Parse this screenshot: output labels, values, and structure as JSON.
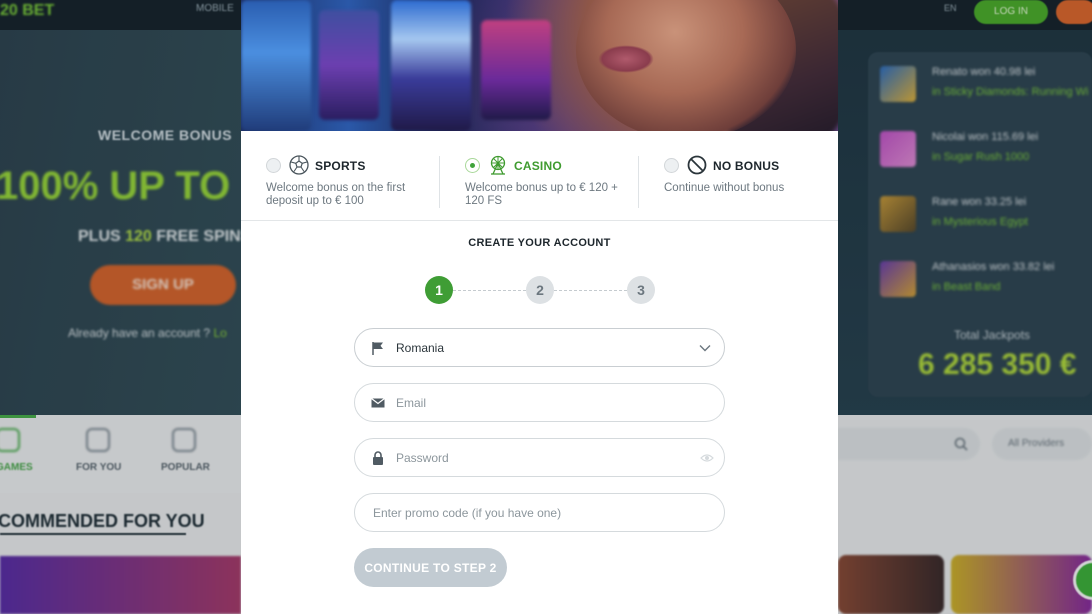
{
  "background": {
    "logo": "20 BET",
    "top_nav_label": "MOBILE",
    "language": "EN",
    "login_label": "LOG IN",
    "welcome_label": "WELCOME BONUS",
    "headline": "100% UP TO",
    "plus_prefix": "PLUS ",
    "plus_number": "120",
    "plus_suffix": " FREE SPINS",
    "signup_label": "SIGN UP",
    "already_text": "Already have an account ? ",
    "already_link": "Lo",
    "nav_items": [
      "GAMES",
      "FOR YOU",
      "POPULAR"
    ],
    "recommended_title": "COMMENDED FOR YOU",
    "winners": [
      {
        "line1": "Renato won 40.98 lei",
        "line2": "in Sticky Diamonds: Running Wi"
      },
      {
        "line1": "Nicolai won 115.69 lei",
        "line2": "in Sugar Rush 1000"
      },
      {
        "line1": "Rane won 33.25 lei",
        "line2": "in Mysterious Egypt"
      },
      {
        "line1": "Athanasios won 33.82 lei",
        "line2": "in Beast Band"
      }
    ],
    "total_jackpots_label": "Total Jackpots",
    "total_jackpots_value": "6 285 350 €",
    "providers_label": "All Providers"
  },
  "bonus_options": [
    {
      "title": "SPORTS",
      "description": "Welcome bonus on the first deposit up to € 100",
      "selected": false,
      "icon": "soccer-ball-icon"
    },
    {
      "title": "CASINO",
      "description": "Welcome bonus up to € 120 + 120 FS",
      "selected": true,
      "icon": "ferris-wheel-icon"
    },
    {
      "title": "NO BONUS",
      "description": "Continue without bonus",
      "selected": false,
      "icon": "no-entry-icon"
    }
  ],
  "form": {
    "title": "CREATE YOUR ACCOUNT",
    "steps": [
      "1",
      "2",
      "3"
    ],
    "active_step": 1,
    "country_value": "Romania",
    "email_placeholder": "Email",
    "password_placeholder": "Password",
    "promo_placeholder": "Enter promo code (if you have one)",
    "continue_label": "CONTINUE TO STEP 2"
  },
  "colors": {
    "accent_green": "#3f9d35",
    "disabled_button": "#c2cbd2"
  }
}
